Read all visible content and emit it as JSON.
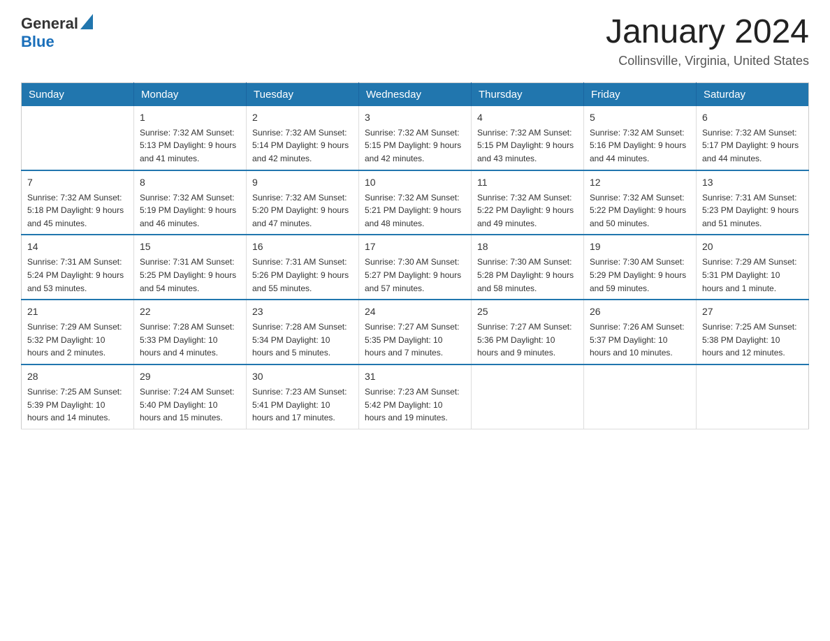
{
  "header": {
    "logo_general": "General",
    "logo_blue": "Blue",
    "month_title": "January 2024",
    "location": "Collinsville, Virginia, United States"
  },
  "weekdays": [
    "Sunday",
    "Monday",
    "Tuesday",
    "Wednesday",
    "Thursday",
    "Friday",
    "Saturday"
  ],
  "weeks": [
    [
      {
        "day": "",
        "info": ""
      },
      {
        "day": "1",
        "info": "Sunrise: 7:32 AM\nSunset: 5:13 PM\nDaylight: 9 hours\nand 41 minutes."
      },
      {
        "day": "2",
        "info": "Sunrise: 7:32 AM\nSunset: 5:14 PM\nDaylight: 9 hours\nand 42 minutes."
      },
      {
        "day": "3",
        "info": "Sunrise: 7:32 AM\nSunset: 5:15 PM\nDaylight: 9 hours\nand 42 minutes."
      },
      {
        "day": "4",
        "info": "Sunrise: 7:32 AM\nSunset: 5:15 PM\nDaylight: 9 hours\nand 43 minutes."
      },
      {
        "day": "5",
        "info": "Sunrise: 7:32 AM\nSunset: 5:16 PM\nDaylight: 9 hours\nand 44 minutes."
      },
      {
        "day": "6",
        "info": "Sunrise: 7:32 AM\nSunset: 5:17 PM\nDaylight: 9 hours\nand 44 minutes."
      }
    ],
    [
      {
        "day": "7",
        "info": "Sunrise: 7:32 AM\nSunset: 5:18 PM\nDaylight: 9 hours\nand 45 minutes."
      },
      {
        "day": "8",
        "info": "Sunrise: 7:32 AM\nSunset: 5:19 PM\nDaylight: 9 hours\nand 46 minutes."
      },
      {
        "day": "9",
        "info": "Sunrise: 7:32 AM\nSunset: 5:20 PM\nDaylight: 9 hours\nand 47 minutes."
      },
      {
        "day": "10",
        "info": "Sunrise: 7:32 AM\nSunset: 5:21 PM\nDaylight: 9 hours\nand 48 minutes."
      },
      {
        "day": "11",
        "info": "Sunrise: 7:32 AM\nSunset: 5:22 PM\nDaylight: 9 hours\nand 49 minutes."
      },
      {
        "day": "12",
        "info": "Sunrise: 7:32 AM\nSunset: 5:22 PM\nDaylight: 9 hours\nand 50 minutes."
      },
      {
        "day": "13",
        "info": "Sunrise: 7:31 AM\nSunset: 5:23 PM\nDaylight: 9 hours\nand 51 minutes."
      }
    ],
    [
      {
        "day": "14",
        "info": "Sunrise: 7:31 AM\nSunset: 5:24 PM\nDaylight: 9 hours\nand 53 minutes."
      },
      {
        "day": "15",
        "info": "Sunrise: 7:31 AM\nSunset: 5:25 PM\nDaylight: 9 hours\nand 54 minutes."
      },
      {
        "day": "16",
        "info": "Sunrise: 7:31 AM\nSunset: 5:26 PM\nDaylight: 9 hours\nand 55 minutes."
      },
      {
        "day": "17",
        "info": "Sunrise: 7:30 AM\nSunset: 5:27 PM\nDaylight: 9 hours\nand 57 minutes."
      },
      {
        "day": "18",
        "info": "Sunrise: 7:30 AM\nSunset: 5:28 PM\nDaylight: 9 hours\nand 58 minutes."
      },
      {
        "day": "19",
        "info": "Sunrise: 7:30 AM\nSunset: 5:29 PM\nDaylight: 9 hours\nand 59 minutes."
      },
      {
        "day": "20",
        "info": "Sunrise: 7:29 AM\nSunset: 5:31 PM\nDaylight: 10 hours\nand 1 minute."
      }
    ],
    [
      {
        "day": "21",
        "info": "Sunrise: 7:29 AM\nSunset: 5:32 PM\nDaylight: 10 hours\nand 2 minutes."
      },
      {
        "day": "22",
        "info": "Sunrise: 7:28 AM\nSunset: 5:33 PM\nDaylight: 10 hours\nand 4 minutes."
      },
      {
        "day": "23",
        "info": "Sunrise: 7:28 AM\nSunset: 5:34 PM\nDaylight: 10 hours\nand 5 minutes."
      },
      {
        "day": "24",
        "info": "Sunrise: 7:27 AM\nSunset: 5:35 PM\nDaylight: 10 hours\nand 7 minutes."
      },
      {
        "day": "25",
        "info": "Sunrise: 7:27 AM\nSunset: 5:36 PM\nDaylight: 10 hours\nand 9 minutes."
      },
      {
        "day": "26",
        "info": "Sunrise: 7:26 AM\nSunset: 5:37 PM\nDaylight: 10 hours\nand 10 minutes."
      },
      {
        "day": "27",
        "info": "Sunrise: 7:25 AM\nSunset: 5:38 PM\nDaylight: 10 hours\nand 12 minutes."
      }
    ],
    [
      {
        "day": "28",
        "info": "Sunrise: 7:25 AM\nSunset: 5:39 PM\nDaylight: 10 hours\nand 14 minutes."
      },
      {
        "day": "29",
        "info": "Sunrise: 7:24 AM\nSunset: 5:40 PM\nDaylight: 10 hours\nand 15 minutes."
      },
      {
        "day": "30",
        "info": "Sunrise: 7:23 AM\nSunset: 5:41 PM\nDaylight: 10 hours\nand 17 minutes."
      },
      {
        "day": "31",
        "info": "Sunrise: 7:23 AM\nSunset: 5:42 PM\nDaylight: 10 hours\nand 19 minutes."
      },
      {
        "day": "",
        "info": ""
      },
      {
        "day": "",
        "info": ""
      },
      {
        "day": "",
        "info": ""
      }
    ]
  ]
}
